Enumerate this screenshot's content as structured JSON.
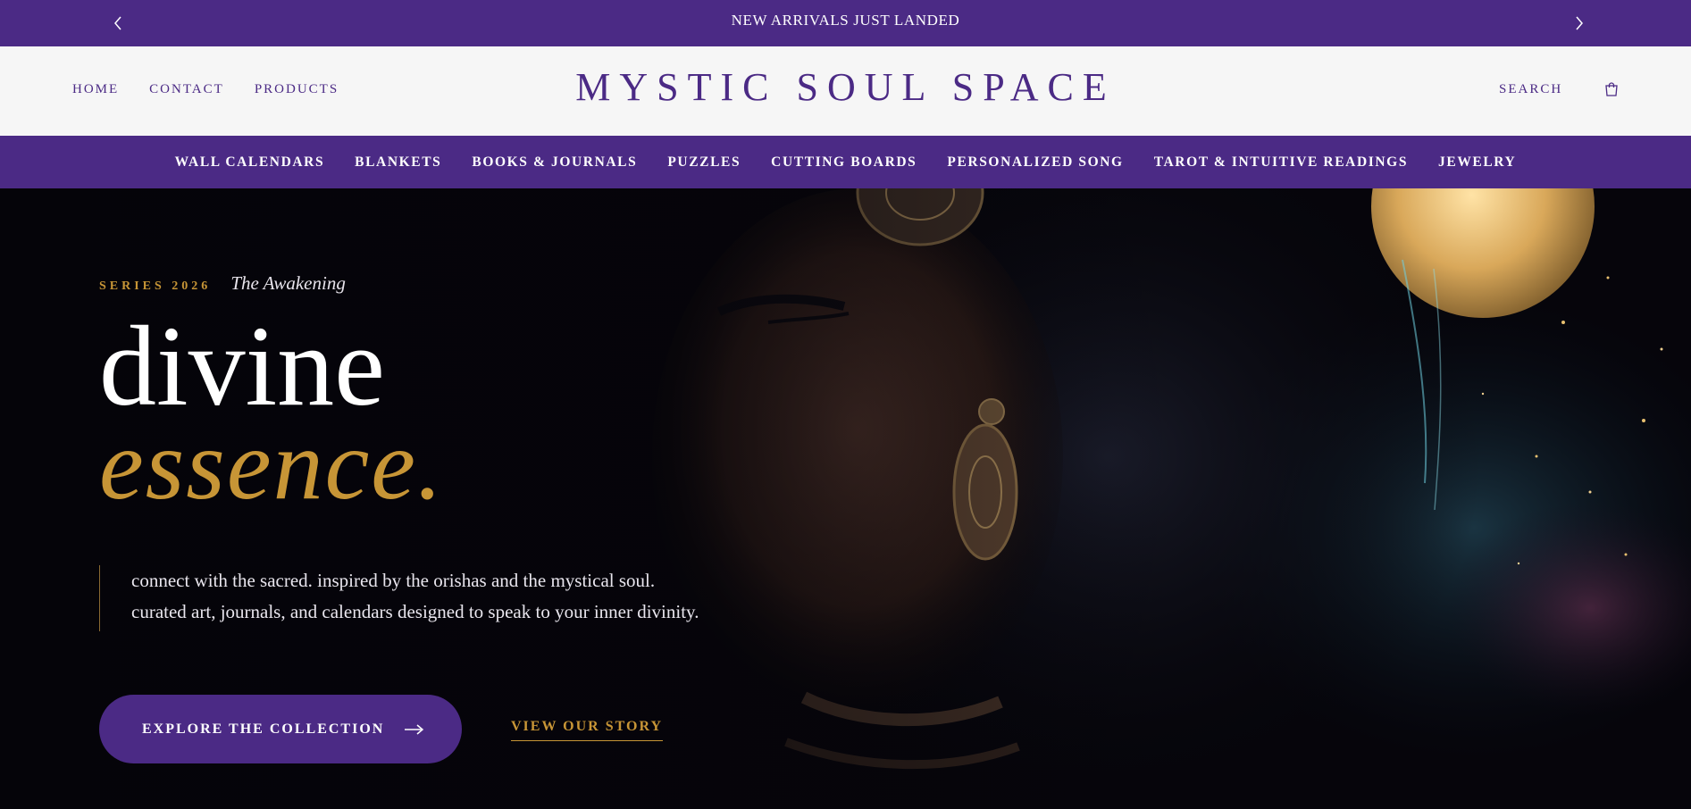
{
  "announcement": {
    "text": "NEW ARRIVALS JUST LANDED",
    "prev_icon": "chevron-left-icon",
    "next_icon": "chevron-right-icon"
  },
  "header": {
    "nav": [
      "HOME",
      "CONTACT",
      "PRODUCTS"
    ],
    "logo": "MYSTIC SOUL SPACE",
    "search_label": "SEARCH",
    "cart_icon": "shopping-bag-icon"
  },
  "categories": [
    "WALL CALENDARS",
    "BLANKETS",
    "BOOKS & JOURNALS",
    "PUZZLES",
    "CUTTING BOARDS",
    "PERSONALIZED SONG",
    "TAROT & INTUITIVE READINGS",
    "JEWELRY"
  ],
  "hero": {
    "series_label": "SERIES 2026",
    "series_name": "The Awakening",
    "headline_line1": "divine",
    "headline_line2": "essence.",
    "description_line1": "connect with the sacred. inspired by the orishas and the mystical soul.",
    "description_line2": "curated art, journals, and calendars designed to speak to your inner divinity.",
    "primary_button": "EXPLORE THE COLLECTION",
    "secondary_link": "VIEW OUR STORY"
  },
  "colors": {
    "brand_purple": "#4b2a85",
    "gold": "#c79536",
    "header_bg": "#f6f6f6",
    "hero_bg": "#050409"
  }
}
